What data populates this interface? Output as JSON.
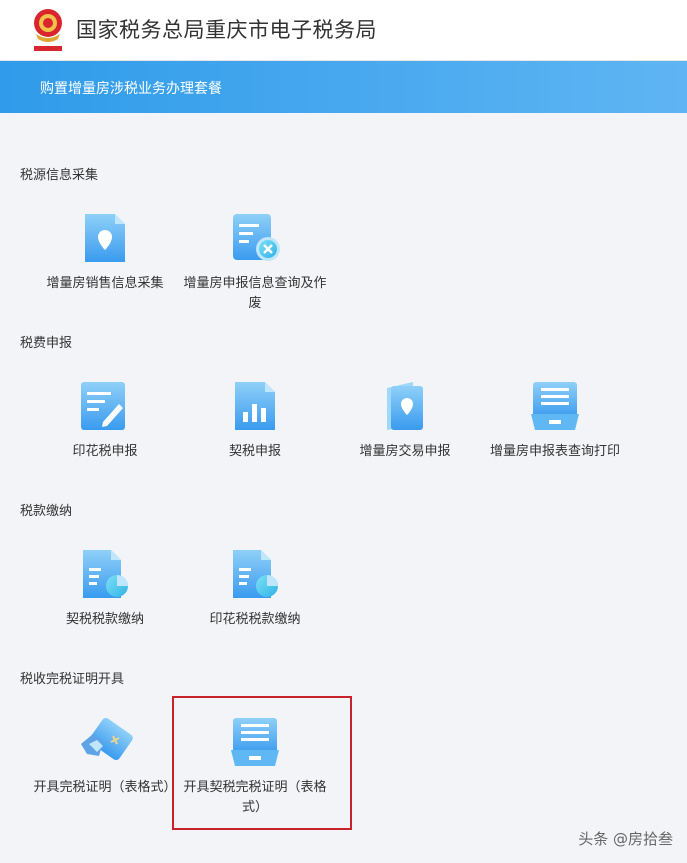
{
  "header": {
    "title": "国家税务总局重庆市电子税务局",
    "emblem_icon": "national-tax-emblem"
  },
  "banner": {
    "title": "购置增量房涉税业务办理套餐"
  },
  "sections": [
    {
      "title": "税源信息采集",
      "items": [
        {
          "label": "增量房销售信息采集",
          "icon": "location-document-icon"
        },
        {
          "label": "增量房申报信息查询及作废",
          "icon": "document-cancel-icon"
        }
      ]
    },
    {
      "title": "税费申报",
      "items": [
        {
          "label": "印花税申报",
          "icon": "edit-document-icon"
        },
        {
          "label": "契税申报",
          "icon": "chart-document-icon"
        },
        {
          "label": "增量房交易申报",
          "icon": "location-book-icon"
        },
        {
          "label": "增量房申报表查询打印",
          "icon": "printer-tray-icon"
        }
      ]
    },
    {
      "title": "税款缴纳",
      "items": [
        {
          "label": "契税税款缴纳",
          "icon": "pie-document-icon"
        },
        {
          "label": "印花税税款缴纳",
          "icon": "pie-document-icon"
        }
      ]
    },
    {
      "title": "税收完税证明开具",
      "items": [
        {
          "label": "开具完税证明（表格式）",
          "icon": "handshake-ticket-icon"
        },
        {
          "label": "开具契税完税证明（表格式）",
          "icon": "printer-tray-icon"
        }
      ]
    }
  ],
  "watermark": "头条 @房拾叁",
  "colors": {
    "brand_blue": "#2f9bea",
    "highlight_red": "#c8232c"
  }
}
